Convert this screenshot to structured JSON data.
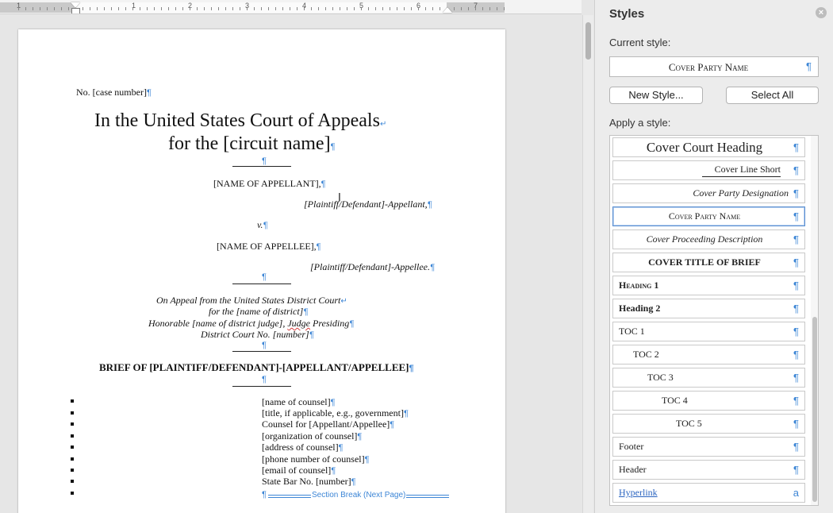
{
  "ruler": {
    "numbers": [
      "1",
      "1",
      "2",
      "3",
      "4",
      "5",
      "6",
      "7"
    ]
  },
  "document": {
    "case_number": "No. [case number]",
    "court_line1": "In the United States Court of Appeals",
    "court_line2": "for the [circuit name]",
    "appellant_name": "[NAME OF APPELLANT],",
    "appellant_role": "[Plaintiff/Defendant]-Appellant,",
    "versus": "v.",
    "appellee_name": "[NAME OF APPELLEE],",
    "appellee_role": "[Plaintiff/Defendant]-Appellee.",
    "appeal_line1": "On Appeal from the United States District Court",
    "appeal_line2": "for the [name of district]",
    "appeal_line3_a": "Honorable [name of district judge], ",
    "appeal_line3_b": "Judge",
    "appeal_line3_c": " Presiding",
    "appeal_line4": "District Court No. [number]",
    "brief_title": "BRIEF OF [PLAINTIFF/DEFENDANT]-[APPELLANT/APPELLEE]",
    "counsel": [
      "[name of counsel]",
      "[title, if applicable, e.g., government]",
      "Counsel for [Appellant/Appellee]",
      "[organization of counsel]",
      "[address of counsel]",
      "[phone number of counsel]",
      "[email of counsel]",
      "State Bar No. [number]"
    ],
    "section_break": "Section Break (Next Page)",
    "pilcrow": "¶",
    "line_break": "↵"
  },
  "styles_pane": {
    "title": "Styles",
    "current_style_label": "Current style:",
    "current_style_value": "Cover Party Name",
    "new_style_button": "New Style...",
    "select_all_button": "Select All",
    "apply_label": "Apply a style:",
    "styles": [
      {
        "name": "Cover Court Heading",
        "mark": "¶"
      },
      {
        "name": "Cover Line Short",
        "mark": "¶"
      },
      {
        "name": "Cover Party Designation",
        "mark": "¶"
      },
      {
        "name": "Cover Party Name",
        "mark": "¶"
      },
      {
        "name": "Cover Proceeding Description",
        "mark": "¶"
      },
      {
        "name": "COVER TITLE OF BRIEF",
        "mark": "¶"
      },
      {
        "name": "Heading 1",
        "mark": "¶"
      },
      {
        "name": "Heading 2",
        "mark": "¶"
      },
      {
        "name": "TOC 1",
        "mark": "¶"
      },
      {
        "name": "TOC 2",
        "mark": "¶"
      },
      {
        "name": "TOC 3",
        "mark": "¶"
      },
      {
        "name": "TOC 4",
        "mark": "¶"
      },
      {
        "name": "TOC 5",
        "mark": "¶"
      },
      {
        "name": "Footer",
        "mark": "¶"
      },
      {
        "name": "Header",
        "mark": "¶"
      },
      {
        "name": "Hyperlink",
        "mark": "a"
      }
    ],
    "accent_color": "#3d86d6"
  }
}
